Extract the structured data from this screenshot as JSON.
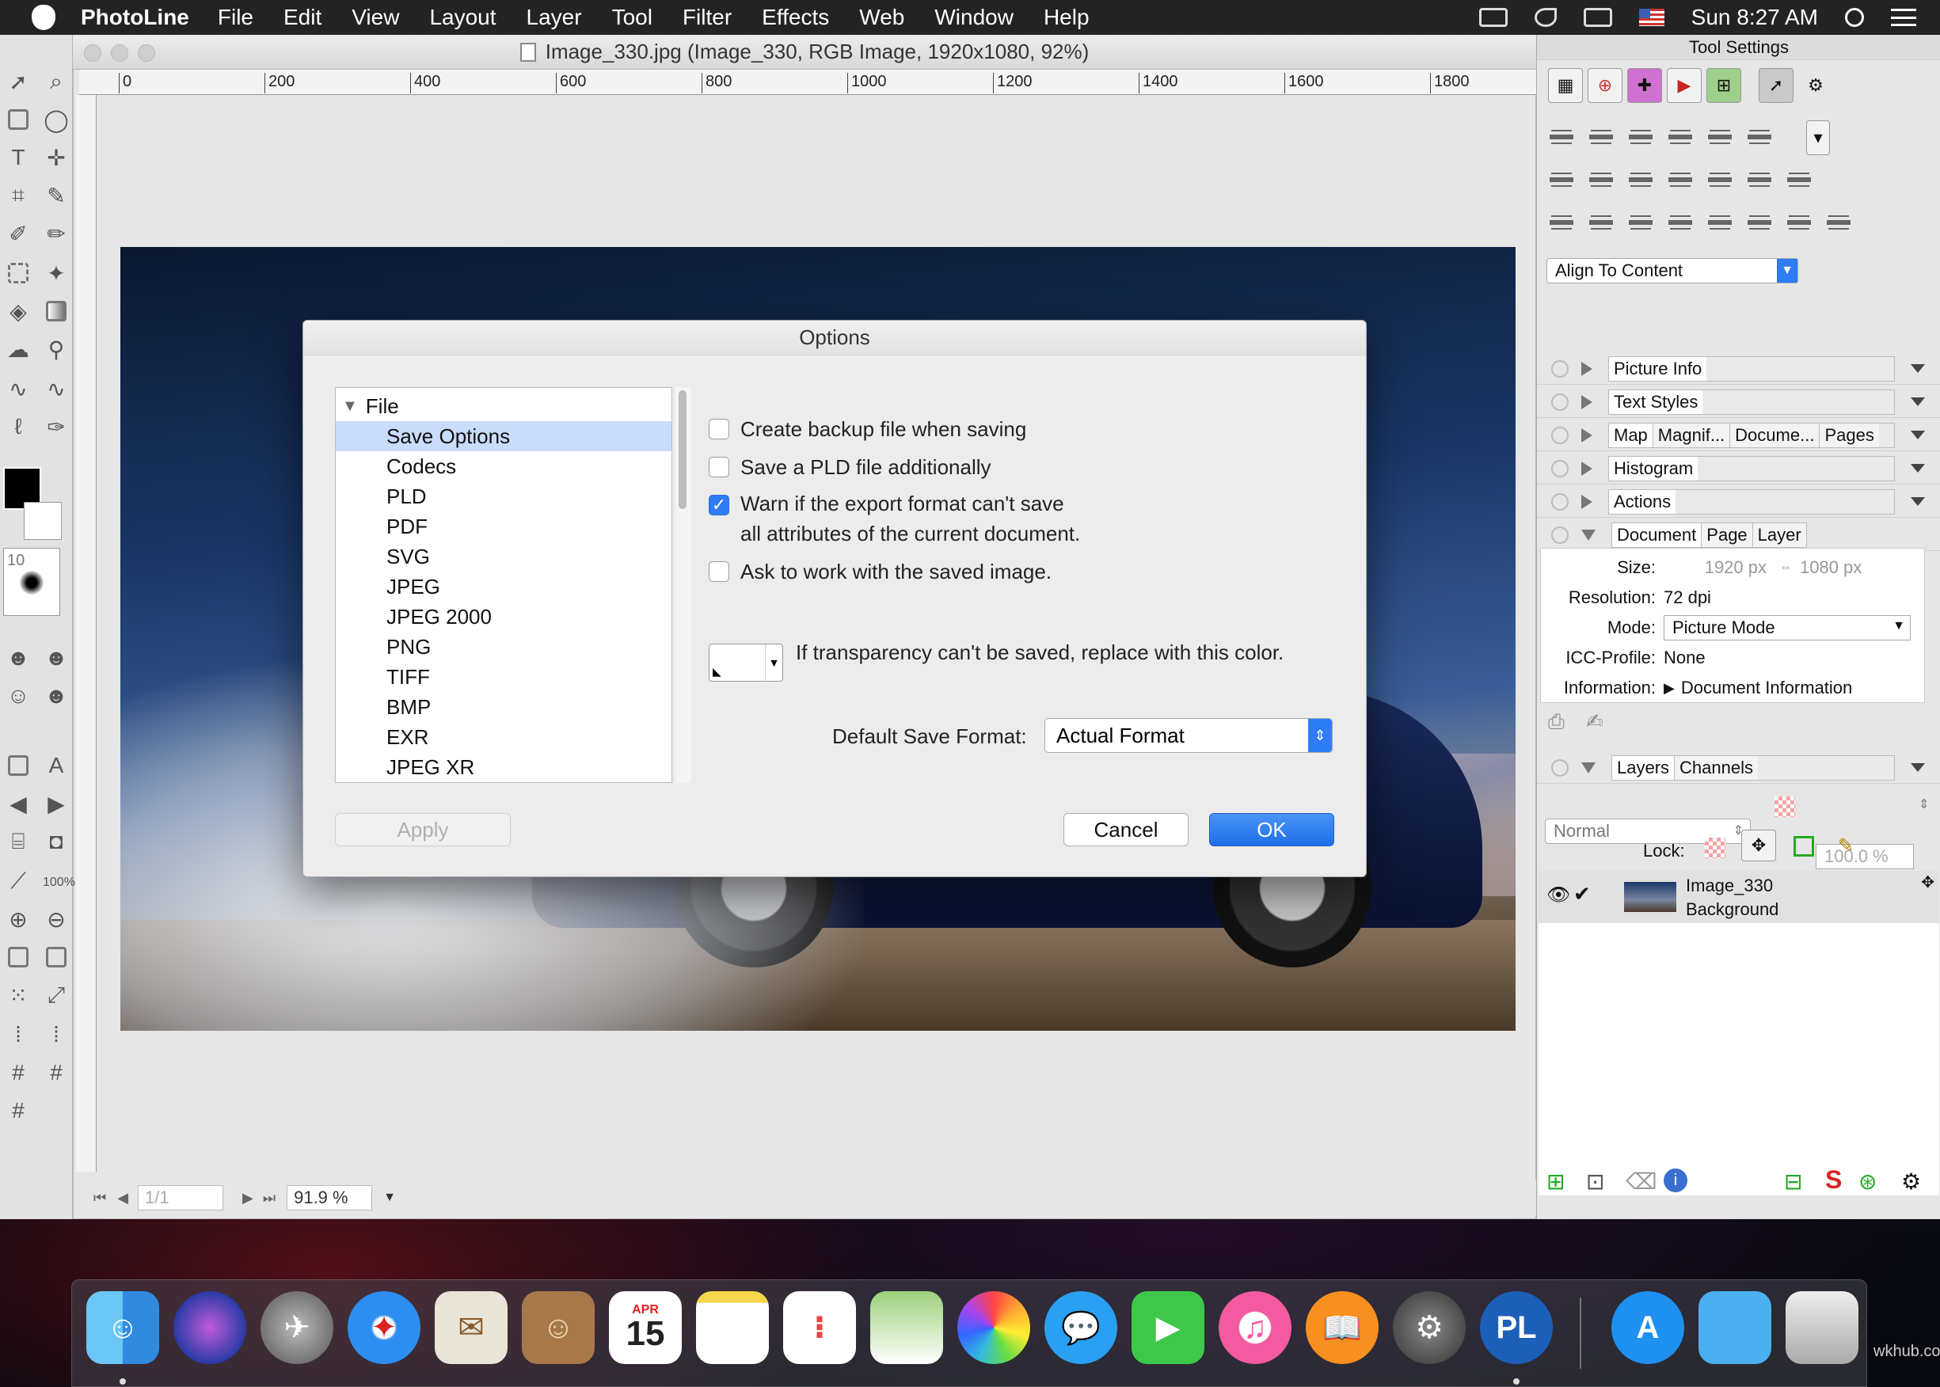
{
  "menubar": {
    "app_name": "PhotoLine",
    "items": [
      "File",
      "Edit",
      "View",
      "Layout",
      "Layer",
      "Tool",
      "Filter",
      "Effects",
      "Web",
      "Window",
      "Help"
    ],
    "clock": "Sun 8:27 AM"
  },
  "window": {
    "title": "Image_330.jpg (Image_330, RGB Image, 1920x1080, 92%)",
    "ruler_marks": [
      "0",
      "200",
      "400",
      "600",
      "800",
      "1000",
      "1200",
      "1400",
      "1600",
      "1800"
    ],
    "status": {
      "page_field": "1/1",
      "zoom": "91.9 %"
    }
  },
  "toolbox": {
    "brush_size": "10",
    "zoom_label": "100%"
  },
  "dialog": {
    "title": "Options",
    "tree_root": "File",
    "tree_items": [
      "Save Options",
      "Codecs",
      "PLD",
      "PDF",
      "SVG",
      "JPEG",
      "JPEG 2000",
      "PNG",
      "TIFF",
      "BMP",
      "EXR",
      "JPEG XR"
    ],
    "selected_item": "Save Options",
    "checkboxes": [
      {
        "label": "Create backup file when saving",
        "checked": false
      },
      {
        "label": "Save a PLD file additionally",
        "checked": false
      },
      {
        "label": "Warn if the export format can't save",
        "label2": "all attributes of the current document.",
        "checked": true
      },
      {
        "label": "Ask to work with the saved image.",
        "checked": false
      }
    ],
    "transparency_label": "If transparency can't be saved, replace with this color.",
    "default_format_label": "Default Save Format:",
    "default_format_value": "Actual Format",
    "apply_label": "Apply",
    "cancel_label": "Cancel",
    "ok_label": "OK"
  },
  "panel": {
    "title": "Tool Settings",
    "align_select": "Align To Content",
    "sections": {
      "picture_info": "Picture Info",
      "text_styles": "Text Styles",
      "map_tabs": [
        "Map",
        "Magnif...",
        "Docume...",
        "Pages"
      ],
      "histogram": "Histogram",
      "actions": "Actions",
      "doc_tabs": [
        "Document",
        "Page",
        "Layer"
      ]
    },
    "document": {
      "size_label": "Size:",
      "width": "1920 px",
      "height": "1080 px",
      "resolution_label": "Resolution:",
      "resolution": "72 dpi",
      "mode_label": "Mode:",
      "mode": "Picture Mode",
      "icc_label": "ICC-Profile:",
      "icc": "None",
      "info_label": "Information:",
      "info": "Document Information"
    },
    "layers_tabs": [
      "Layers",
      "Channels"
    ],
    "blend_mode": "Normal",
    "opacity": "100.0 %",
    "lock_label": "Lock:",
    "layer": {
      "name": "Image_330",
      "sub": "Background"
    }
  },
  "dock": {
    "calendar_month": "APR",
    "calendar_day": "15"
  },
  "watermark": "wkhub.com",
  "colors": {
    "accent": "#2e7cf6",
    "selection": "#c9dcfb"
  }
}
